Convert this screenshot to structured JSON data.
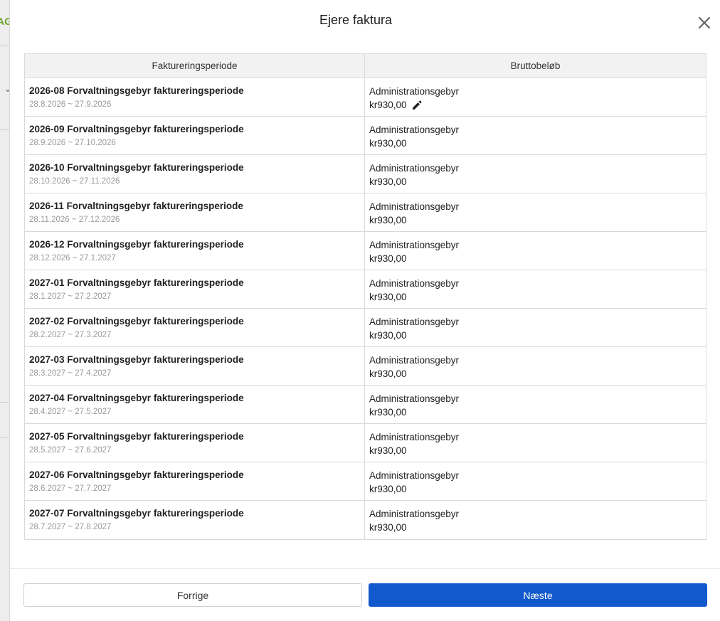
{
  "background": {
    "partial_text": "AG"
  },
  "modal": {
    "title": "Ejere faktura",
    "close_label": "×"
  },
  "table": {
    "headers": [
      "Faktureringsperiode",
      "Bruttobeløb"
    ],
    "rows": [
      {
        "title": "2026-08 Forvaltningsgebyr faktureringsperiode",
        "dates": "28.8.2026 ~ 27.9.2026",
        "fee_label": "Administrationsgebyr",
        "amount": "kr930,00",
        "editable": true
      },
      {
        "title": "2026-09 Forvaltningsgebyr faktureringsperiode",
        "dates": "28.9.2026 ~ 27.10.2026",
        "fee_label": "Administrationsgebyr",
        "amount": "kr930,00",
        "editable": false
      },
      {
        "title": "2026-10 Forvaltningsgebyr faktureringsperiode",
        "dates": "28.10.2026 ~ 27.11.2026",
        "fee_label": "Administrationsgebyr",
        "amount": "kr930,00",
        "editable": false
      },
      {
        "title": "2026-11 Forvaltningsgebyr faktureringsperiode",
        "dates": "28.11.2026 ~ 27.12.2026",
        "fee_label": "Administrationsgebyr",
        "amount": "kr930,00",
        "editable": false
      },
      {
        "title": "2026-12 Forvaltningsgebyr faktureringsperiode",
        "dates": "28.12.2026 ~ 27.1.2027",
        "fee_label": "Administrationsgebyr",
        "amount": "kr930,00",
        "editable": false
      },
      {
        "title": "2027-01 Forvaltningsgebyr faktureringsperiode",
        "dates": "28.1.2027 ~ 27.2.2027",
        "fee_label": "Administrationsgebyr",
        "amount": "kr930,00",
        "editable": false
      },
      {
        "title": "2027-02 Forvaltningsgebyr faktureringsperiode",
        "dates": "28.2.2027 ~ 27.3.2027",
        "fee_label": "Administrationsgebyr",
        "amount": "kr930,00",
        "editable": false
      },
      {
        "title": "2027-03 Forvaltningsgebyr faktureringsperiode",
        "dates": "28.3.2027 ~ 27.4.2027",
        "fee_label": "Administrationsgebyr",
        "amount": "kr930,00",
        "editable": false
      },
      {
        "title": "2027-04 Forvaltningsgebyr faktureringsperiode",
        "dates": "28.4.2027 ~ 27.5.2027",
        "fee_label": "Administrationsgebyr",
        "amount": "kr930,00",
        "editable": false
      },
      {
        "title": "2027-05 Forvaltningsgebyr faktureringsperiode",
        "dates": "28.5.2027 ~ 27.6.2027",
        "fee_label": "Administrationsgebyr",
        "amount": "kr930,00",
        "editable": false
      },
      {
        "title": "2027-06 Forvaltningsgebyr faktureringsperiode",
        "dates": "28.6.2027 ~ 27.7.2027",
        "fee_label": "Administrationsgebyr",
        "amount": "kr930,00",
        "editable": false
      },
      {
        "title": "2027-07 Forvaltningsgebyr faktureringsperiode",
        "dates": "28.7.2027 ~ 27.8.2027",
        "fee_label": "Administrationsgebyr",
        "amount": "kr930,00",
        "editable": false
      }
    ]
  },
  "footer": {
    "prev_label": "Forrige",
    "next_label": "Næste"
  },
  "icons": {
    "close": "close-icon",
    "edit": "pencil-icon"
  },
  "colors": {
    "primary": "#1159cc",
    "header_bg": "#f2f2f2",
    "muted_text": "#9a9a9a",
    "accent_green": "#6aa329"
  }
}
